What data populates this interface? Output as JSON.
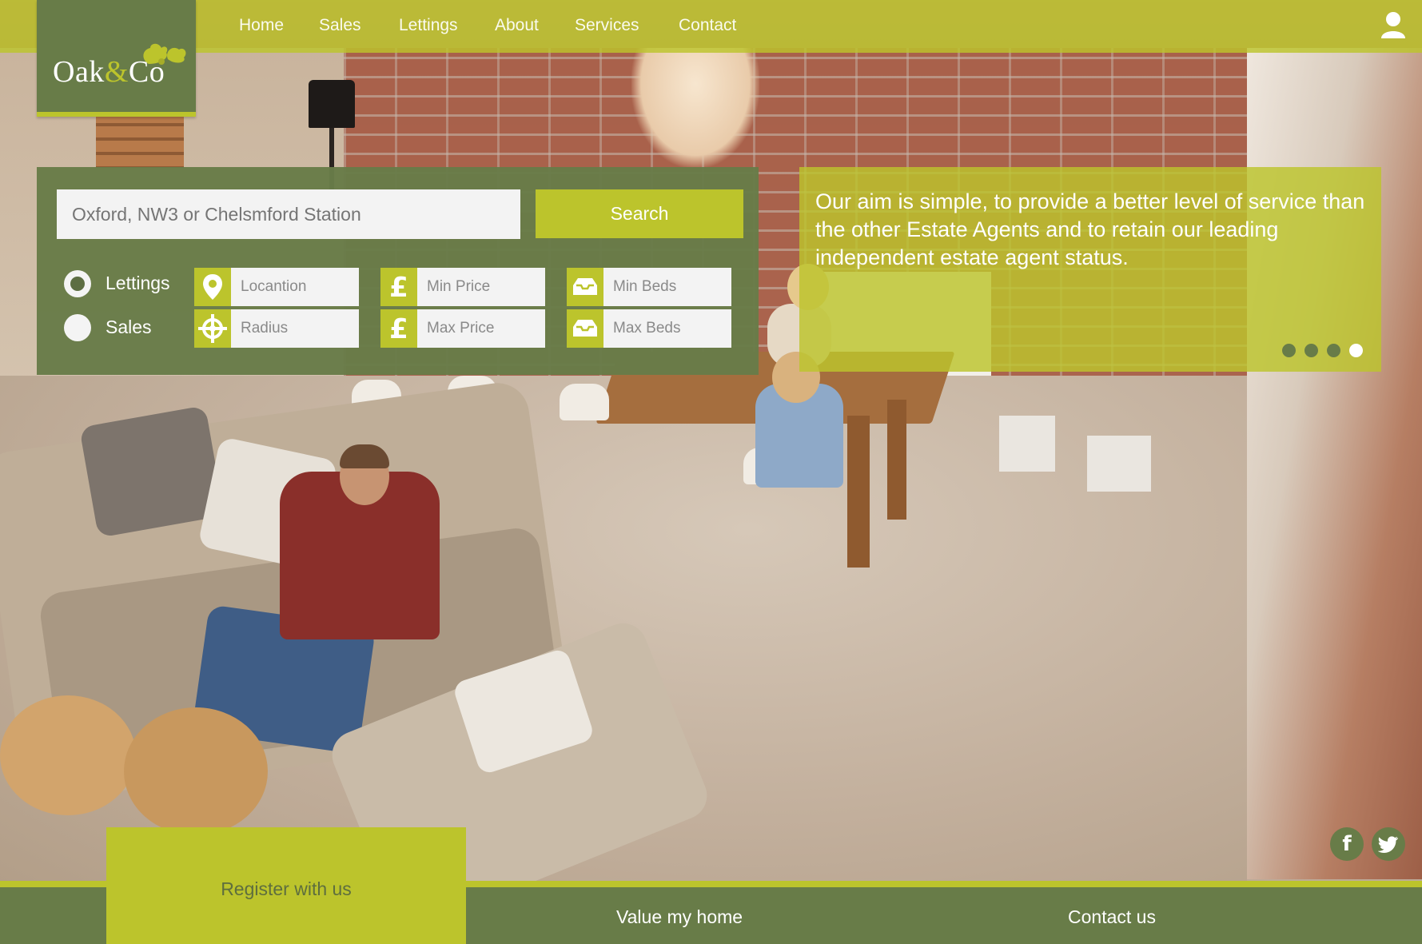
{
  "brand": {
    "name": "Oak",
    "amp": "&",
    "suffix": "Co"
  },
  "nav": {
    "items": [
      {
        "label": "Home"
      },
      {
        "label": "Sales"
      },
      {
        "label": "Lettings"
      },
      {
        "label": "About"
      },
      {
        "label": "Services"
      },
      {
        "label": "Contact"
      }
    ],
    "user_icon": "user-icon"
  },
  "search": {
    "placeholder": "Oxford, NW3 or Chelsmford Station",
    "button_label": "Search",
    "mode": {
      "options": [
        {
          "label": "Lettings",
          "selected": true
        },
        {
          "label": "Sales",
          "selected": false
        }
      ]
    },
    "fields": {
      "location": {
        "placeholder": "Locantion",
        "icon": "map-pin-icon"
      },
      "radius": {
        "placeholder": "Radius",
        "icon": "crosshair-icon"
      },
      "min_price": {
        "placeholder": "Min Price",
        "icon": "pound-icon"
      },
      "max_price": {
        "placeholder": "Max Price",
        "icon": "pound-icon"
      },
      "min_beds": {
        "placeholder": "Min Beds",
        "icon": "bed-icon"
      },
      "max_beds": {
        "placeholder": "Max Beds",
        "icon": "bed-icon"
      }
    }
  },
  "hero": {
    "quote": "Our aim is simple, to provide a better level of service than the other Estate Agents and to retain our leading independent estate agent status.",
    "slide_count": 4,
    "active_slide": 4
  },
  "social": [
    {
      "icon": "facebook-icon",
      "glyph": "f"
    },
    {
      "icon": "twitter-icon"
    }
  ],
  "footer": {
    "register_label": "Register with us",
    "value_label": "Value my home",
    "contact_label": "Contact us"
  },
  "colors": {
    "olive": "#687c48",
    "lime": "#bcc42c",
    "field_bg": "#f3f3f3"
  }
}
